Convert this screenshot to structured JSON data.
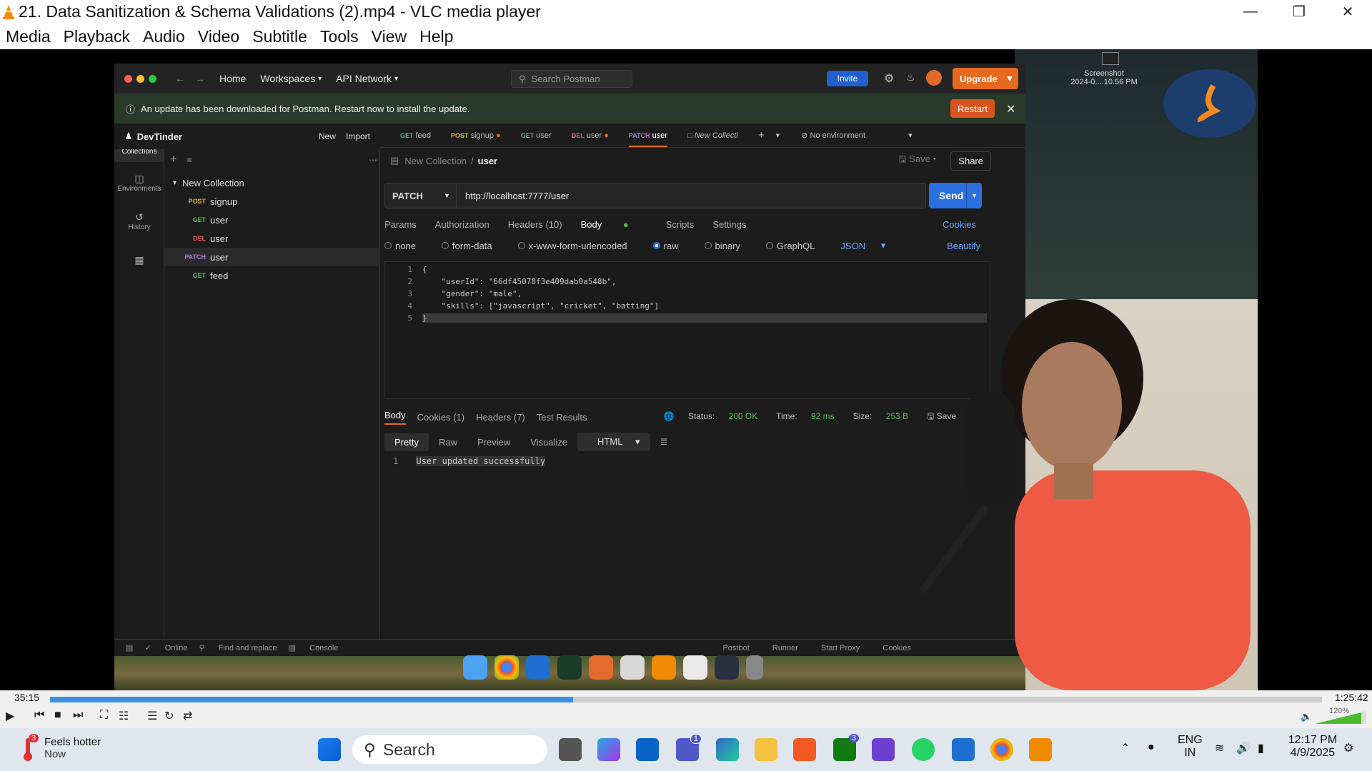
{
  "window": {
    "title": "21. Data Sanitization & Schema Validations (2).mp4 - VLC media player"
  },
  "menu": [
    "Media",
    "Playback",
    "Audio",
    "Video",
    "Subtitle",
    "Tools",
    "View",
    "Help"
  ],
  "desktop": {
    "screenshot_label": "Screenshot",
    "screenshot_time": "2024-0....10.56 PM"
  },
  "postman": {
    "nav": {
      "home": "Home",
      "workspaces": "Workspaces",
      "api_network": "API Network"
    },
    "search_placeholder": "Search Postman",
    "invite": "Invite",
    "upgrade": "Upgrade",
    "banner": "An update has been downloaded for Postman. Restart now to install the update.",
    "restart": "Restart",
    "workspace": "DevTinder",
    "new_btn": "New",
    "import_btn": "Import",
    "sidebar": [
      "Collections",
      "Environments",
      "History"
    ],
    "collection": "New Collection",
    "tree": [
      {
        "method": "POST",
        "name": "signup",
        "color": "#e0b43c"
      },
      {
        "method": "GET",
        "name": "user",
        "color": "#5fb35f"
      },
      {
        "method": "DEL",
        "name": "user",
        "color": "#e06060"
      },
      {
        "method": "PATCH",
        "name": "user",
        "color": "#b07ad8"
      },
      {
        "method": "GET",
        "name": "feed",
        "color": "#5fb35f"
      }
    ],
    "tabs": [
      {
        "method": "GET",
        "name": "feed"
      },
      {
        "method": "POST",
        "name": "signup"
      },
      {
        "method": "GET",
        "name": "user"
      },
      {
        "method": "DEL",
        "name": "user"
      },
      {
        "method": "PATCH",
        "name": "user"
      },
      {
        "method": "",
        "name": "New Collecti"
      }
    ],
    "environment": "No environment",
    "breadcrumb": {
      "collection": "New Collection",
      "sep": "/",
      "request": "user"
    },
    "save": "Save",
    "share": "Share",
    "method": "PATCH",
    "url": "http://localhost:7777/user",
    "send": "Send",
    "req_tabs": [
      "Params",
      "Authorization",
      "Headers (10)",
      "Body",
      "Scripts",
      "Settings"
    ],
    "cookies": "Cookies",
    "body_opts": [
      "none",
      "form-data",
      "x-www-form-urlencoded",
      "raw",
      "binary",
      "GraphQL"
    ],
    "body_format": "JSON",
    "beautify": "Beautify",
    "code_lines": [
      "{",
      "    \"userId\": \"66df45078f3e409dab0a548b\",",
      "    \"gender\": \"male\",",
      "    \"skills\": [\"javascript\", \"cricket\", \"batting\"]",
      "}"
    ],
    "resp_tabs": [
      "Body",
      "Cookies (1)",
      "Headers (7)",
      "Test Results"
    ],
    "status": {
      "label": "Status:",
      "value": "200 OK",
      "time_label": "Time:",
      "time": "92 ms",
      "size_label": "Size:",
      "size": "253 B",
      "save": "Save"
    },
    "resp_views": [
      "Pretty",
      "Raw",
      "Preview",
      "Visualize"
    ],
    "resp_format": "HTML",
    "response_line": "User updated successfully",
    "footer": [
      "Online",
      "Find and replace",
      "Console",
      "Postbot",
      "Runner",
      "Start Proxy",
      "Cookies"
    ]
  },
  "player": {
    "elapsed": "35:15",
    "total": "1:25:42",
    "progress": 0.411,
    "volume_label": "120%"
  },
  "taskbar": {
    "weather_title": "Feels hotter",
    "weather_sub": "Now",
    "weather_badge": "3",
    "search": "Search",
    "lang1": "ENG",
    "lang2": "IN",
    "time": "12:17 PM",
    "date": "4/9/2025",
    "badge_teams": "1",
    "badge_xbox": "3"
  }
}
